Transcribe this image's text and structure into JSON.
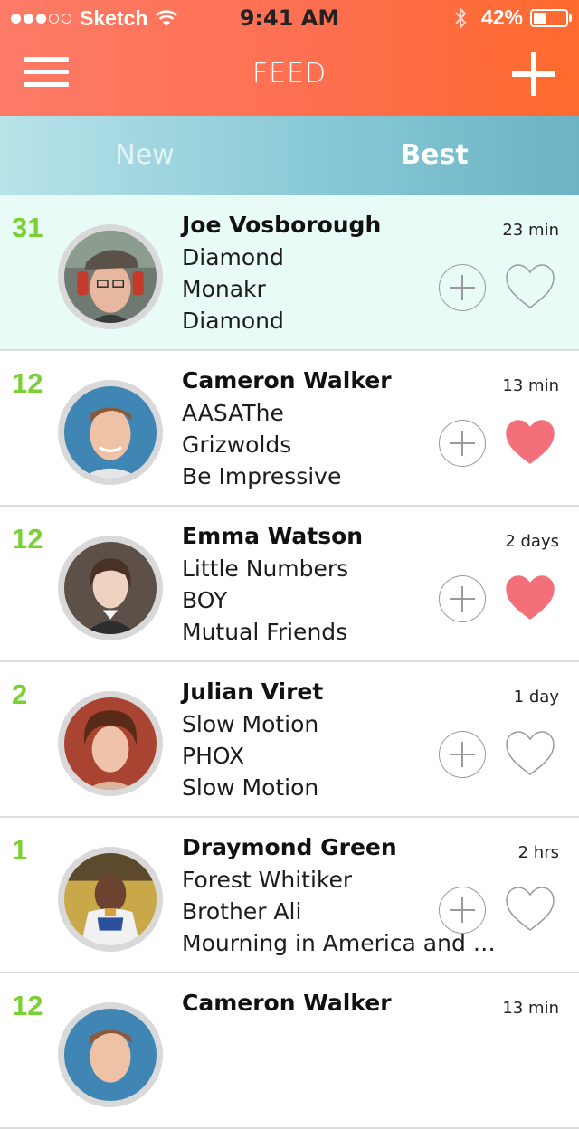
{
  "status_bar": {
    "carrier": "Sketch",
    "time": "9:41 AM",
    "battery": "42%",
    "battery_level": 0.42
  },
  "header": {
    "title": "FEED"
  },
  "tabs": [
    {
      "label": "New",
      "active": false
    },
    {
      "label": "Best",
      "active": true
    }
  ],
  "colors": {
    "score_green": "#79d133",
    "heart_red": "#f3707a",
    "header_orange": "#fe6f50",
    "tabs_teal": "#88c9d6",
    "highlight_row": "#e8fbf6"
  },
  "feed": [
    {
      "score": "31",
      "name": "Joe Vosborough",
      "time": "23 min",
      "lines": [
        "Diamond",
        "Monakr",
        "Diamond"
      ],
      "liked": false,
      "highlight": true
    },
    {
      "score": "12",
      "name": "Cameron Walker",
      "time": "13 min",
      "lines": [
        "AASAThe",
        "Grizwolds",
        "Be Impressive"
      ],
      "liked": true,
      "highlight": false
    },
    {
      "score": "12",
      "name": "Emma Watson",
      "time": "2 days",
      "lines": [
        "Little Numbers",
        "BOY",
        "Mutual Friends"
      ],
      "liked": true,
      "highlight": false
    },
    {
      "score": "2",
      "name": "Julian Viret",
      "time": "1 day",
      "lines": [
        "Slow Motion",
        "PHOX",
        "Slow Motion"
      ],
      "liked": false,
      "highlight": false
    },
    {
      "score": "1",
      "name": "Draymond Green",
      "time": "2 hrs",
      "lines": [
        "Forest Whitiker",
        "Brother Ali",
        "Mourning in America and Dre…"
      ],
      "liked": false,
      "highlight": false
    },
    {
      "score": "12",
      "name": "Cameron Walker",
      "time": "13 min",
      "lines": [
        "",
        "",
        ""
      ],
      "liked": false,
      "highlight": false
    }
  ]
}
